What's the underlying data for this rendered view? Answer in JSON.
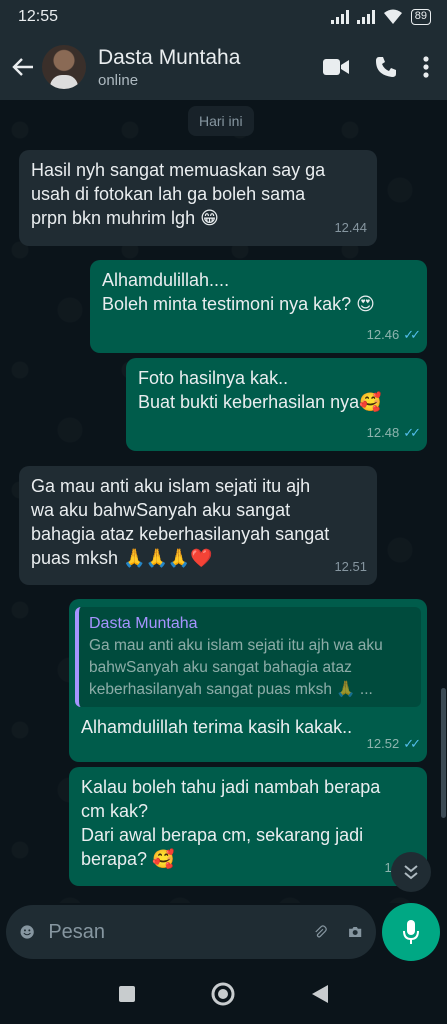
{
  "status_bar": {
    "time": "12:55",
    "battery": "89"
  },
  "header": {
    "contact_name": "Dasta Muntaha",
    "contact_status": "online"
  },
  "chat": {
    "date_label": "Hari ini",
    "messages": [
      {
        "direction": "in",
        "text": "Hasil nyh sangat memuaskan say ga\nusah di fotokan lah ga boleh sama\nprpn bkn muhrim lgh 😁",
        "time": "12.44"
      },
      {
        "direction": "out",
        "text": "Alhamdulillah....\nBoleh minta testimoni nya kak? 😍",
        "time": "12.46"
      },
      {
        "direction": "out",
        "text": "Foto hasilnya kak..\nBuat bukti keberhasilan nya🥰",
        "time": "12.48"
      },
      {
        "direction": "in",
        "text": "Ga mau anti aku islam sejati itu ajh\nwa aku bahwSanyah aku sangat\nbahagia ataz keberhasilanyah sangat\npuas mksh 🙏🙏🙏❤️",
        "time": "12.51"
      },
      {
        "direction": "out",
        "quote_name": "Dasta Muntaha",
        "quote_text": "Ga mau anti aku islam sejati itu ajh wa aku bahwSanyah aku sangat bahagia ataz keberhasilanyah sangat puas mksh 🙏 ...",
        "text": "Alhamdulillah terima kasih kakak..",
        "time": "12.52"
      },
      {
        "direction": "out",
        "text": "Kalau boleh tahu jadi nambah berapa\ncm kak?\nDari awal berapa cm, sekarang jadi\nberapa? 🥰",
        "time": "12.52"
      }
    ]
  },
  "input": {
    "placeholder": "Pesan",
    "value": ""
  },
  "colors": {
    "incoming": "#202c33",
    "outgoing": "#005c4b",
    "accent": "#00a884",
    "read_ticks": "#53bdeb"
  },
  "icons": [
    "back-arrow-icon",
    "video-call-icon",
    "phone-icon",
    "more-vert-icon",
    "emoji-icon",
    "attach-icon",
    "camera-icon",
    "mic-icon",
    "scroll-down-icon",
    "nav-recents-icon",
    "nav-home-icon",
    "nav-back-icon"
  ]
}
